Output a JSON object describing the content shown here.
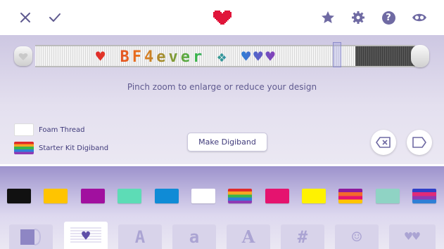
{
  "topbar": {
    "icons": {
      "close": "close-icon",
      "confirm": "check-icon",
      "heart": "heart-icon",
      "star": "star-icon",
      "settings": "gear-icon",
      "help": "help-icon",
      "eye": "eye-icon"
    },
    "help_glyph": "?"
  },
  "band": {
    "text": "♥ BF4ever ❖ ♥♥♥"
  },
  "hint_text": "Pinch zoom to enlarge or reduce your design",
  "legend": [
    {
      "label": "Foam Thread",
      "swatch": "#ffffff"
    },
    {
      "label": "Starter Kit Digiband",
      "swatch": "rainbow"
    }
  ],
  "make_button_label": "Make Digiband",
  "palette": {
    "colors": [
      "#111111",
      "#ffc400",
      "#a1109f",
      "#5ddcb6",
      "#0f8bd6",
      "#ffffff",
      "rainbow",
      "#e5136f",
      "#fff200",
      "#f26a2b",
      "#8fd3c4",
      "rainbow2"
    ]
  },
  "tabs": [
    {
      "name": "pattern-tab",
      "glyph": ""
    },
    {
      "name": "heart-tab",
      "glyph": "♥"
    },
    {
      "name": "font-a-tab",
      "glyph": "A"
    },
    {
      "name": "font-lower-a-tab",
      "glyph": "a"
    },
    {
      "name": "font-a-outline-tab",
      "glyph": "A"
    },
    {
      "name": "hashtag-tab",
      "glyph": "#"
    },
    {
      "name": "emoji-tab",
      "glyph": "☺"
    },
    {
      "name": "hearts-tab",
      "glyph": "♥♥"
    }
  ]
}
